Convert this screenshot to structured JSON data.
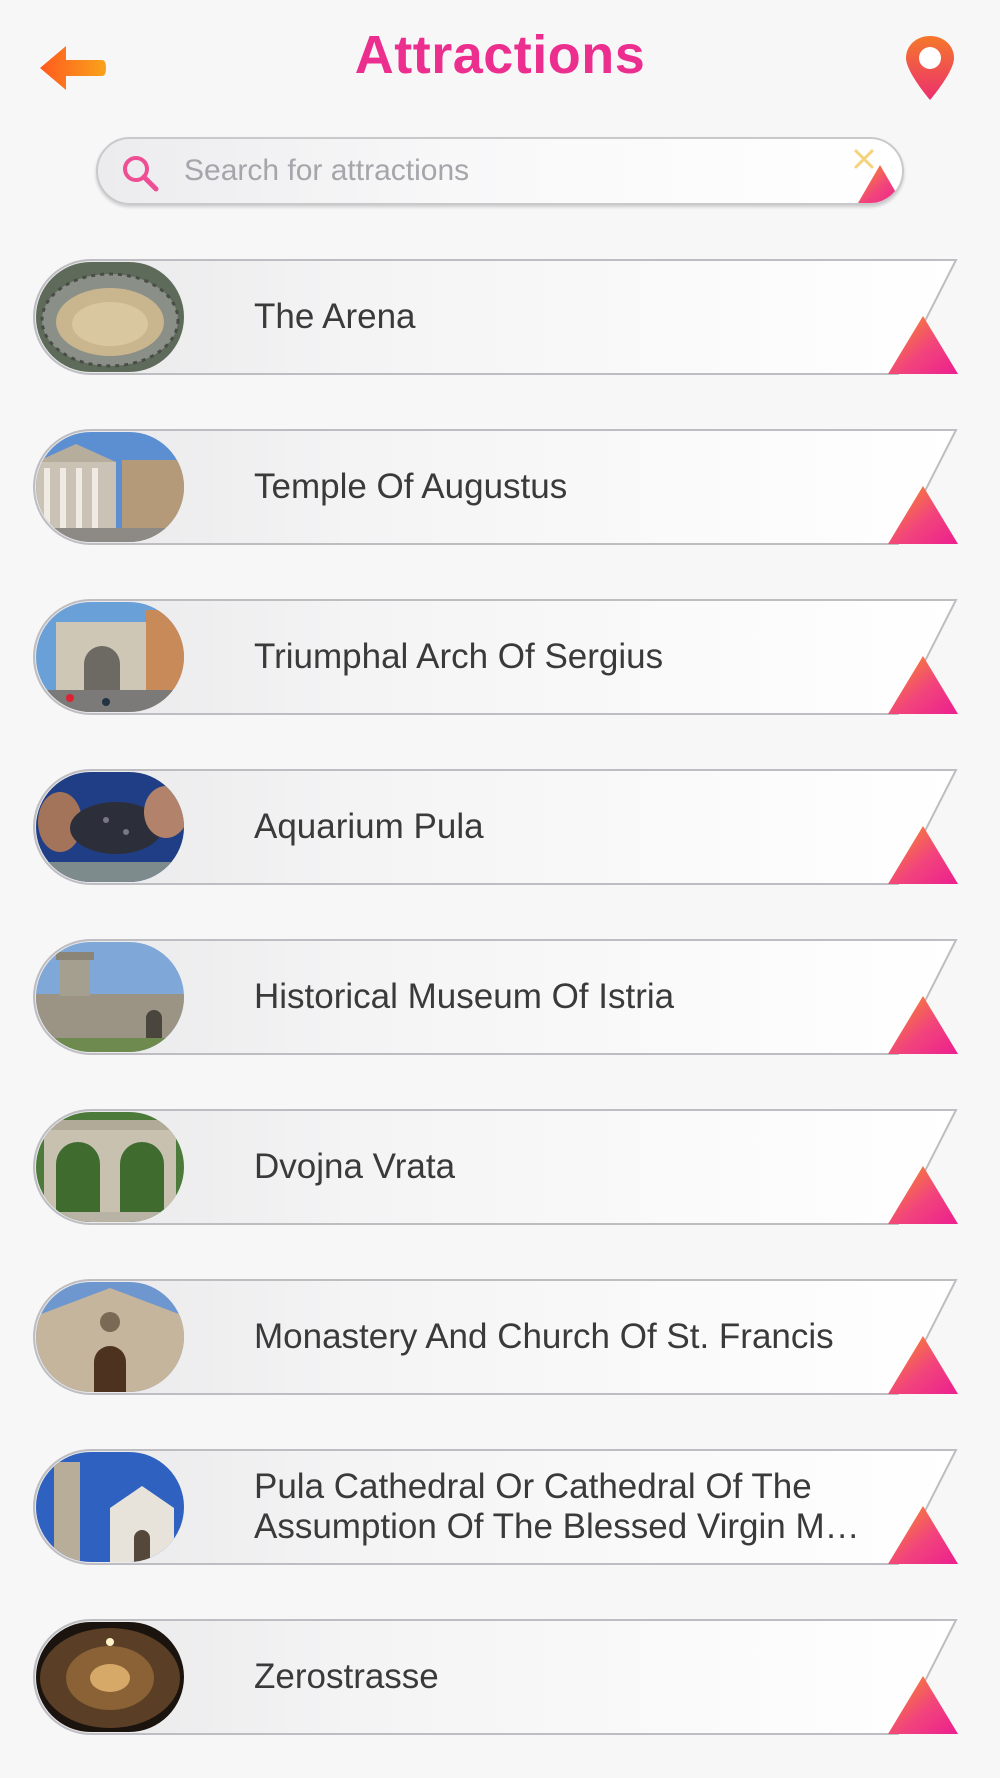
{
  "header": {
    "title": "Attractions",
    "back_icon": "back-arrow-icon",
    "map_icon": "map-pin-icon"
  },
  "search": {
    "placeholder": "Search for attractions",
    "value": ""
  },
  "colors": {
    "accent_pink": "#ec2f8f",
    "accent_orange": "#f7941d"
  },
  "attractions": [
    {
      "name": "The Arena"
    },
    {
      "name": "Temple Of Augustus"
    },
    {
      "name": "Triumphal Arch Of Sergius"
    },
    {
      "name": "Aquarium Pula"
    },
    {
      "name": "Historical Museum Of Istria"
    },
    {
      "name": "Dvojna Vrata"
    },
    {
      "name": "Monastery And Church Of St. Francis"
    },
    {
      "name": "Pula Cathedral Or Cathedral Of The Assumption Of The Blessed Virgin M…"
    },
    {
      "name": "Zerostrasse"
    }
  ]
}
